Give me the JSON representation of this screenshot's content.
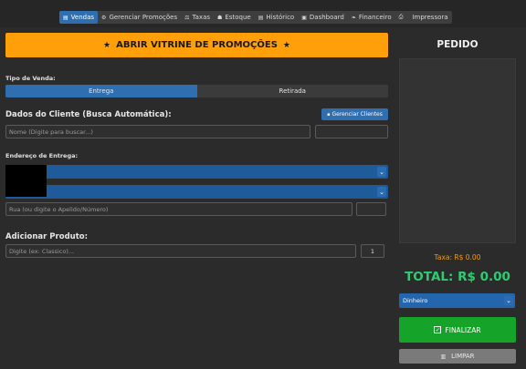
{
  "nav": {
    "tabs": [
      {
        "icon": "cart-icon",
        "glyph": "▤",
        "label": "Vendas",
        "active": true
      },
      {
        "icon": "gear-icon",
        "glyph": "⚙",
        "label": "Gerenciar Promoções"
      },
      {
        "icon": "scale-icon",
        "glyph": "⚖",
        "label": "Taxas"
      },
      {
        "icon": "box-icon",
        "glyph": "☗",
        "label": "Estoque"
      },
      {
        "icon": "list-icon",
        "glyph": "▤",
        "label": "Histórico"
      },
      {
        "icon": "dashboard-icon",
        "glyph": "▣",
        "label": "Dashboard"
      },
      {
        "icon": "money-icon",
        "glyph": "❧",
        "label": "Financeiro"
      },
      {
        "icon": "printer-icon",
        "glyph": "⎙",
        "label": "Impressora"
      }
    ]
  },
  "vitrine": {
    "label": "ABRIR VITRINE DE PROMOÇÕES"
  },
  "sale_type": {
    "label": "Tipo de Venda:",
    "options": [
      "Entrega",
      "Retirada"
    ],
    "selected": "Entrega"
  },
  "client": {
    "title": "Dados do Cliente (Busca Automática):",
    "manage_label": "Gerenciar Clientes",
    "name_placeholder": "Nome (Digite para buscar...)",
    "phone_value": ""
  },
  "address": {
    "label": "Endereço de Entrega:",
    "street_placeholder": "Rua (ou digite o Apelido/Número)",
    "number_value": ""
  },
  "product": {
    "title": "Adicionar Produto:",
    "placeholder": "Digite (ex: Classico)...",
    "qty": "1"
  },
  "order": {
    "title": "PEDIDO",
    "tax": "Taxa: R$ 0.00",
    "total": "TOTAL: R$ 0.00",
    "payment": "Dinheiro",
    "finalize_label": "FINALIZAR",
    "clear_label": "LIMPAR"
  },
  "colors": {
    "accent": "#2f6fb0",
    "orange": "#ff9f0a",
    "green": "#16a329",
    "total_green": "#2ecc71",
    "tax_orange": "#f39c12"
  }
}
